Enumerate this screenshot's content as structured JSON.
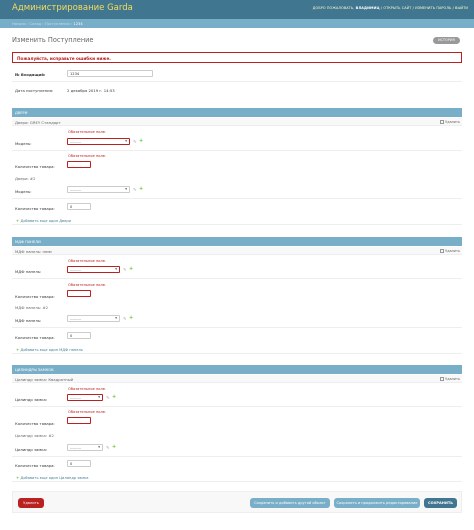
{
  "header": {
    "branding": "Администрирование Garda",
    "welcome": "ДОБРО ПОЖАЛОВАТЬ,",
    "user": "ВЛАДИМИЦ",
    "site_link": "ОТКРЫТЬ САЙТ",
    "password_link": "ИЗМЕНИТЬ ПАРОЛЬ",
    "logout_link": "ВЫЙТИ",
    "sep": "/"
  },
  "breadcrumbs": {
    "home": "Начало",
    "app": "Склад",
    "model": "Поступления",
    "current": "1234",
    "sep": "›"
  },
  "page": {
    "title": "Изменить Поступление",
    "history_button": "ИСТОРИЯ",
    "error_note": "Пожалуйста, исправьте ошибки ниже."
  },
  "main_fields": {
    "incoming_no_label": "№ Входящий:",
    "incoming_no_value": "1234",
    "date_label": "Дата поступления:",
    "date_value": "2 декабря 2019 г. 14:53"
  },
  "common": {
    "required_error": "Обязательное поле.",
    "empty_option": "---------",
    "chevron": "▾",
    "plus": "+",
    "pencil": "✎",
    "delete_label": "Удалить",
    "qty_label": "Количество товара:"
  },
  "doors": {
    "section_title": "ДВЕРИ",
    "item1_title": "Двери: GREY Стандарт",
    "model_label": "Модель:",
    "item1_qty": "",
    "item2_title": "Двери: #2",
    "item2_qty": "0",
    "add_link": "Добавить еще один Двери"
  },
  "mdf": {
    "section_title": "МДФ ПАНЕЛИ",
    "item1_title": "МДФ панель: немс",
    "panel_label": "МДФ панель:",
    "item1_qty": "",
    "item2_title": "МДФ панель: #2",
    "item2_qty": "0",
    "add_link": "Добавить еще один МДФ панель"
  },
  "locks": {
    "section_title": "ЦИЛИНДРЫ ЗАМКОВ",
    "item1_title": "Цилиндр замка: Квадратный",
    "cyl_label": "Цилиндр замка:",
    "item1_qty": "",
    "item2_title": "Цилиндр замка: #2",
    "item2_qty": "0",
    "add_link": "Добавить еще один Цилиндр замка"
  },
  "submit": {
    "delete": "Удалить",
    "save_add": "Сохранить и добавить другой объект",
    "save_continue": "Сохранить и продолжить редактирование",
    "save": "СОХРАНИТЬ"
  },
  "colors": {
    "header_bg": "#417690",
    "module_bg": "#79aec8",
    "error": "#ba2121",
    "add_green": "#70bf2b"
  }
}
